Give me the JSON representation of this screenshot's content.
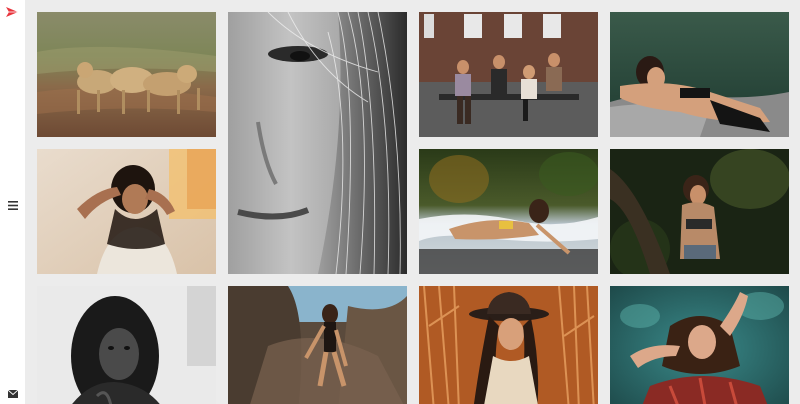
{
  "app": {
    "brand_color": "#e8343c",
    "background": "#ececec",
    "sidebar_background": "#ffffff"
  },
  "sidebar": {
    "logo_icon": "paper-plane-logo-icon",
    "menu_icon": "hamburger-menu-icon",
    "contact_icon": "envelope-icon"
  },
  "gallery": {
    "photos": [
      {
        "subject": "lions-in-grassland",
        "tone": "color"
      },
      {
        "subject": "woman-face-closeup",
        "tone": "black-and-white"
      },
      {
        "subject": "group-on-bench-brick-building",
        "tone": "color"
      },
      {
        "subject": "woman-reclining-on-rock-by-water",
        "tone": "color"
      },
      {
        "subject": "woman-in-white-room",
        "tone": "color"
      },
      {
        "subject": "woman-lying-in-surf",
        "tone": "color"
      },
      {
        "subject": "woman-in-dark-forest",
        "tone": "color"
      },
      {
        "subject": "woman-long-hair-portrait",
        "tone": "black-and-white"
      },
      {
        "subject": "woman-crouching-on-rocks",
        "tone": "color"
      },
      {
        "subject": "woman-with-hat-in-ferns",
        "tone": "color"
      },
      {
        "subject": "woman-floating-in-water",
        "tone": "color"
      }
    ]
  }
}
